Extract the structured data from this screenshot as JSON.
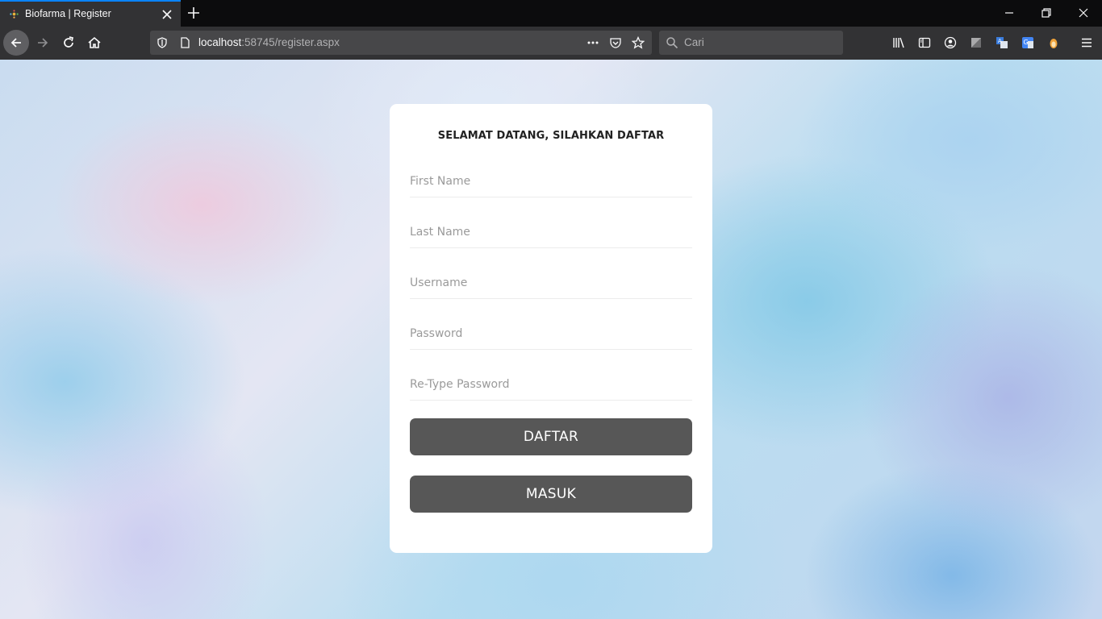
{
  "browser": {
    "tab_title": "Biofarma | Register",
    "url_host": "localhost",
    "url_rest": ":58745/register.aspx",
    "search_placeholder": "Cari",
    "icons": [
      "back-icon",
      "forward-icon",
      "reload-icon",
      "home-icon",
      "shield-icon",
      "page-icon",
      "more-icon",
      "pocket-icon",
      "star-icon",
      "search-icon",
      "library-icon",
      "sidebar-icon",
      "account-icon",
      "extension-icon",
      "translate-icon",
      "google-translate-icon",
      "addon-icon",
      "menu-icon",
      "minimize-icon",
      "restore-icon",
      "close-icon",
      "plus-icon"
    ]
  },
  "form": {
    "heading": "SELAMAT DATANG, SILAHKAN DAFTAR",
    "fields": [
      {
        "placeholder": "First Name"
      },
      {
        "placeholder": "Last Name"
      },
      {
        "placeholder": "Username"
      },
      {
        "placeholder": "Password"
      },
      {
        "placeholder": "Re-Type Password"
      }
    ],
    "register_label": "DAFTAR",
    "login_label": "MASUK"
  },
  "colors": {
    "button": "#575757",
    "tab_accent": "#0a84ff",
    "card": "#ffffff"
  }
}
